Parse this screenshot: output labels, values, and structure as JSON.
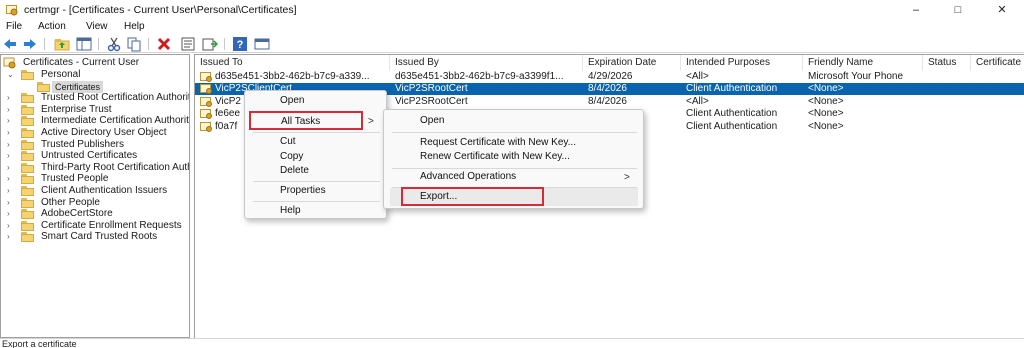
{
  "window": {
    "title": "certmgr - [Certificates - Current User\\Personal\\Certificates]",
    "minimize": "–",
    "maximize": "□",
    "close": "✕"
  },
  "menubar": {
    "items": [
      "File",
      "Action",
      "View",
      "Help"
    ]
  },
  "toolbar": {
    "icons": [
      "back-icon",
      "forward-icon",
      "up-folder-icon",
      "show-hide-tree-icon",
      "cut-icon",
      "copy-icon",
      "delete-icon",
      "properties-icon",
      "refresh-icon",
      "export-list-icon",
      "help-icon",
      "console-icon"
    ]
  },
  "tree": {
    "root": "Certificates - Current User",
    "items": [
      {
        "label": "Personal",
        "expanded": true
      },
      {
        "label": "Certificates",
        "child": true,
        "selected": true
      },
      {
        "label": "Trusted Root Certification Authorities"
      },
      {
        "label": "Enterprise Trust"
      },
      {
        "label": "Intermediate Certification Authorities"
      },
      {
        "label": "Active Directory User Object"
      },
      {
        "label": "Trusted Publishers"
      },
      {
        "label": "Untrusted Certificates"
      },
      {
        "label": "Third-Party Root Certification Authorities"
      },
      {
        "label": "Trusted People"
      },
      {
        "label": "Client Authentication Issuers"
      },
      {
        "label": "Other People"
      },
      {
        "label": "AdobeCertStore"
      },
      {
        "label": "Certificate Enrollment Requests"
      },
      {
        "label": "Smart Card Trusted Roots"
      }
    ]
  },
  "list": {
    "columns": [
      "Issued To",
      "Issued By",
      "Expiration Date",
      "Intended Purposes",
      "Friendly Name",
      "Status",
      "Certificate"
    ],
    "rows": [
      {
        "issued_to": "d635e451-3bb2-462b-b7c9-a339...",
        "issued_by": "d635e451-3bb2-462b-b7c9-a3399f1...",
        "expiration": "4/29/2026",
        "purposes": "<All>",
        "friendly": "Microsoft Your Phone",
        "selected": false
      },
      {
        "issued_to": "VicP2SClientCert",
        "issued_by": "VicP2SRootCert",
        "expiration": "8/4/2026",
        "purposes": "Client Authentication",
        "friendly": "<None>",
        "selected": true
      },
      {
        "issued_to": "VicP2",
        "issued_by": "VicP2SRootCert",
        "expiration": "8/4/2026",
        "purposes": "<All>",
        "friendly": "<None>",
        "selected": false
      },
      {
        "issued_to": "fe6ee",
        "issued_by": "",
        "expiration": "",
        "purposes": "Client Authentication",
        "friendly": "<None>",
        "selected": false
      },
      {
        "issued_to": "f0a7f",
        "issued_by": "",
        "expiration": "",
        "purposes": "Client Authentication",
        "friendly": "<None>",
        "selected": false
      }
    ]
  },
  "context_menu": {
    "open": "Open",
    "all_tasks": "All Tasks",
    "cut": "Cut",
    "copy": "Copy",
    "delete": "Delete",
    "properties": "Properties",
    "help": "Help",
    "submenu_arrow": ">"
  },
  "submenu": {
    "open": "Open",
    "request_new_key": "Request Certificate with New Key...",
    "renew_new_key": "Renew Certificate with New Key...",
    "advanced": "Advanced Operations",
    "export": "Export...",
    "submenu_arrow": ">"
  },
  "status": {
    "text": "Export a certificate"
  },
  "colors": {
    "selection": "#0a64ad",
    "highlight": "#d62a36",
    "folder": "#f4d370"
  }
}
